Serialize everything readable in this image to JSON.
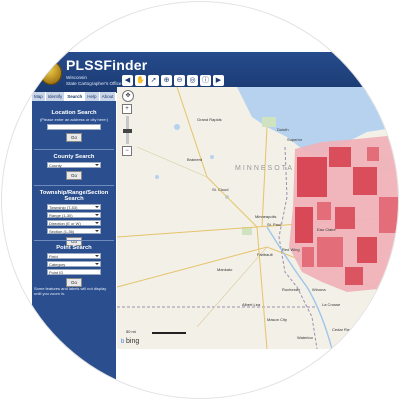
{
  "app": {
    "title": "PLSSFinder",
    "subtitle_line1": "Wisconsin",
    "subtitle_line2": "State Cartographer's Office"
  },
  "toolbar": {
    "tools": [
      {
        "name": "back-icon",
        "glyph": "◀"
      },
      {
        "name": "pan-icon",
        "glyph": "✋"
      },
      {
        "name": "select-icon",
        "glyph": "➚"
      },
      {
        "name": "zoom-in-icon",
        "glyph": "⊕"
      },
      {
        "name": "zoom-out-icon",
        "glyph": "⊖"
      },
      {
        "name": "globe-icon",
        "glyph": "◎"
      },
      {
        "name": "info-icon",
        "glyph": "ⓘ"
      },
      {
        "name": "forward-icon",
        "glyph": "▶"
      }
    ]
  },
  "tabs": [
    {
      "label": "Map",
      "active": false
    },
    {
      "label": "Identify",
      "active": false
    },
    {
      "label": "Search",
      "active": true
    },
    {
      "label": "Help",
      "active": false
    },
    {
      "label": "About",
      "active": false
    }
  ],
  "panel": {
    "location": {
      "title": "Location Search",
      "note": "(Please enter an address or city here:)",
      "input_value": "",
      "go": "Go"
    },
    "county": {
      "title": "County Search",
      "select": "County",
      "go": "Go"
    },
    "trs": {
      "title": "Township/Range/Section Search",
      "selects": [
        "Township (T-53)",
        "Range (1-30)",
        "Direction (E or W)",
        "Section (1-36)"
      ],
      "go": "Go"
    },
    "point": {
      "title": "Point Search",
      "selects": [
        "Field",
        "Category",
        "Point ID"
      ],
      "go": "Go"
    },
    "footnote": "Some features and labels will not display until you zoom in."
  },
  "map": {
    "state_label": "MINNESOTA",
    "cities": [
      "Duluth",
      "Superior",
      "Grand Rapids",
      "Brainerd",
      "St. Cloud",
      "Minneapolis",
      "St. Paul",
      "Rochester",
      "Mankato",
      "Albert Lea",
      "Faribault",
      "Red Wing",
      "Winona",
      "La Crosse",
      "Cedar Rapids",
      "Waterloo",
      "Mason City",
      "Eau Claire"
    ],
    "zoom_pan": "✥",
    "zoom_in": "+",
    "zoom_out": "−",
    "scale_text": "50 mi",
    "attribution": "bing",
    "attribution_icon": "b"
  },
  "colors": {
    "header": "#1b3a72",
    "panel": "#2b4f8e",
    "parcel_dark": "#d63c4a",
    "parcel_light": "#efb2b9"
  }
}
